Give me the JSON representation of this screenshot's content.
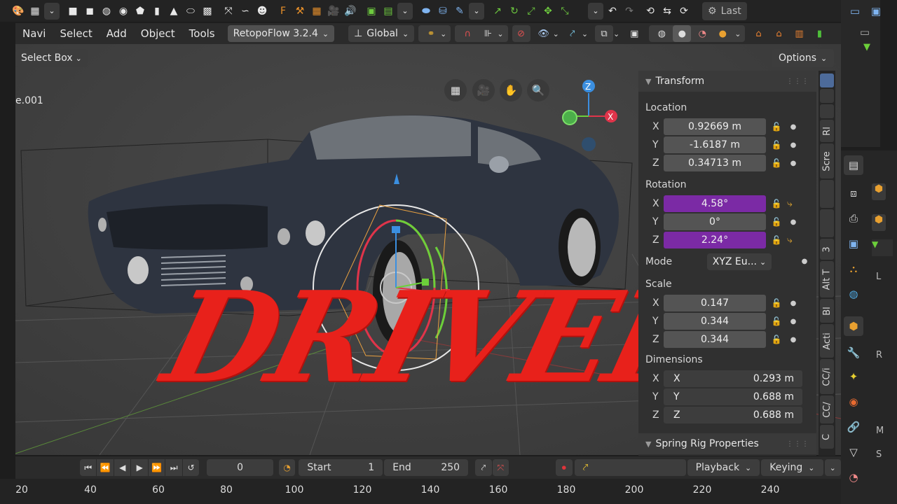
{
  "menus": [
    "Navi",
    "Select",
    "Add",
    "Object",
    "Tools"
  ],
  "addon_dropdown": "RetopoFlow 3.2.4",
  "transform_orientation": "Global",
  "last_button": "Last",
  "select_mode": "Select Box",
  "options_label": "Options",
  "object_name": "e.001",
  "overlay_text": "DRIVER",
  "n_panel": {
    "transform_title": "Transform",
    "location_label": "Location",
    "location": [
      {
        "axis": "X",
        "value": "0.92669 m"
      },
      {
        "axis": "Y",
        "value": "-1.6187 m"
      },
      {
        "axis": "Z",
        "value": "0.34713 m"
      }
    ],
    "rotation_label": "Rotation",
    "rotation": [
      {
        "axis": "X",
        "value": "4.58°"
      },
      {
        "axis": "Y",
        "value": "0°"
      },
      {
        "axis": "Z",
        "value": "2.24°"
      }
    ],
    "mode_label": "Mode",
    "mode_value": "XYZ Eu...",
    "scale_label": "Scale",
    "scale": [
      {
        "axis": "X",
        "value": "0.147"
      },
      {
        "axis": "Y",
        "value": "0.344"
      },
      {
        "axis": "Z",
        "value": "0.344"
      }
    ],
    "dimensions_label": "Dimensions",
    "dimensions": [
      {
        "axis": "X",
        "inner": "X",
        "value": "0.293 m"
      },
      {
        "axis": "Y",
        "inner": "Y",
        "value": "0.688 m"
      },
      {
        "axis": "Z",
        "inner": "Z",
        "value": "0.688 m"
      }
    ],
    "spring_title": "Spring Rig Properties"
  },
  "side_tabs": [
    "Rl",
    "Scre",
    "3",
    "Alt T",
    "Bl",
    "Acti",
    "CC/i",
    "CC/",
    "C"
  ],
  "right_area_letters": [
    "L",
    "R",
    "M",
    "S"
  ],
  "timeline": {
    "current_frame": "0",
    "start_label": "Start",
    "start_value": "1",
    "end_label": "End",
    "end_value": "250",
    "playback_label": "Playback",
    "keying_label": "Keying"
  },
  "ruler_ticks": [
    "20",
    "40",
    "60",
    "80",
    "100",
    "120",
    "140",
    "160",
    "180",
    "200",
    "220",
    "240"
  ],
  "colors": {
    "anim_field": "#7b2aa5",
    "overlay_red": "#e8211b",
    "x_axis": "#e0344a",
    "y_axis": "#6ccf3a",
    "z_axis": "#3b8fe0"
  }
}
